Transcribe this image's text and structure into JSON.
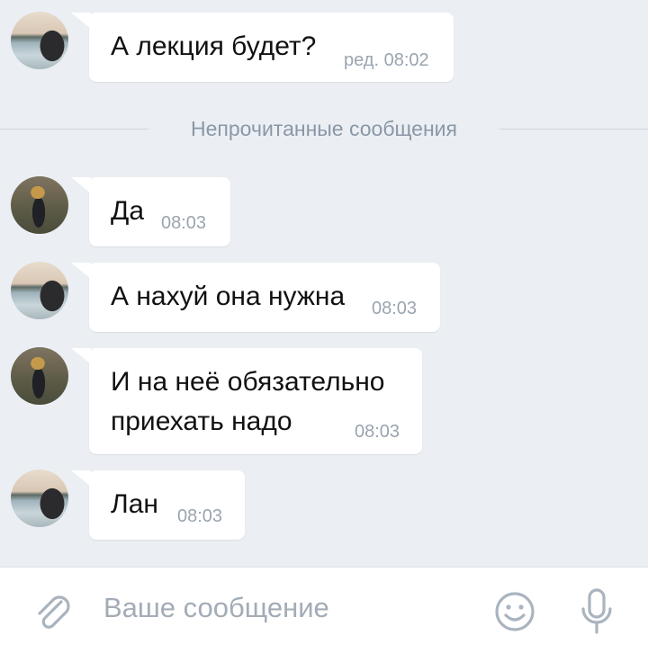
{
  "messages": [
    {
      "text": "А лекция будет?",
      "time": "ред. 08:02",
      "avatar": "lake"
    },
    {
      "text": "Да",
      "time": "08:03",
      "avatar": "field"
    },
    {
      "text": "А нахуй она нужна",
      "time": "08:03",
      "avatar": "lake"
    },
    {
      "text_line1": "И на неё обязательно",
      "text_line2": "приехать надо",
      "time": "08:03",
      "avatar": "field"
    },
    {
      "text": "Лан",
      "time": "08:03",
      "avatar": "lake"
    }
  ],
  "divider": {
    "label": "Непрочитанные сообщения"
  },
  "composer": {
    "placeholder": "Ваше сообщение"
  },
  "icons": [
    "attach-icon",
    "emoji-icon",
    "microphone-icon"
  ],
  "colors": {
    "background": "#ebeff4",
    "bubble": "#ffffff",
    "time": "#9aa4af",
    "divider_text": "#8a97a6",
    "icon": "#aab4bf"
  }
}
